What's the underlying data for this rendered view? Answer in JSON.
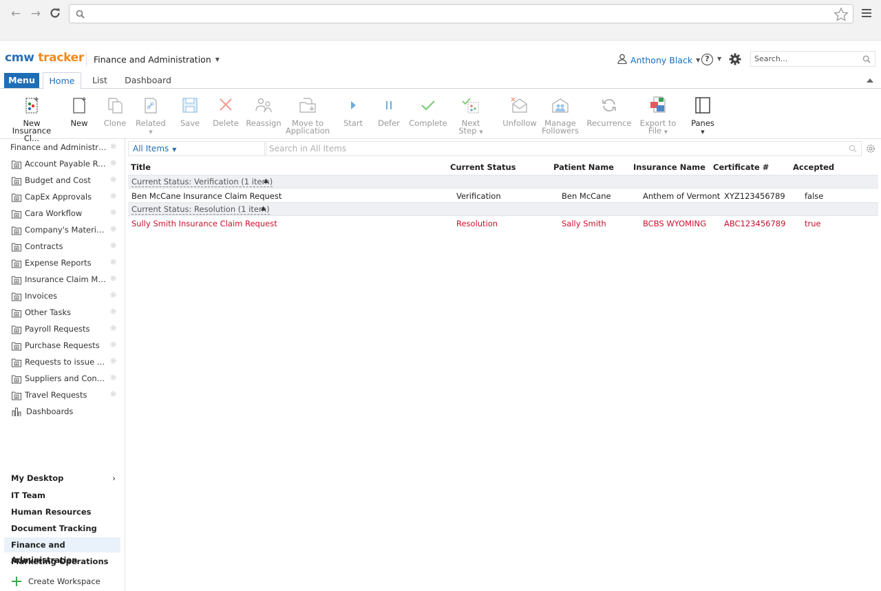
{
  "browser": {
    "url": ""
  },
  "header": {
    "logo_part1": "cmw",
    "logo_part2": "tracker",
    "workspace": "Finance and Administration",
    "user": "Anthony Black",
    "help": "?",
    "search_placeholder": "Search..."
  },
  "tabs": {
    "menu": "Menu",
    "home": "Home",
    "list": "List",
    "dashboard": "Dashboard"
  },
  "ribbon": {
    "new_insurance_l1": "New",
    "new_insurance_l2": "Insurance Cl...",
    "new": "New",
    "clone": "Clone",
    "related": "Related",
    "save": "Save",
    "delete": "Delete",
    "reassign": "Reassign",
    "move_l1": "Move to",
    "move_l2": "Application",
    "start": "Start",
    "defer": "Defer",
    "complete": "Complete",
    "next_l1": "Next",
    "next_l2": "Step",
    "unfollow": "Unfollow",
    "manage_l1": "Manage",
    "manage_l2": "Followers",
    "recurrence": "Recurrence",
    "export_l1": "Export to",
    "export_l2": "File",
    "panes": "Panes"
  },
  "sidebar": {
    "workspace_title": "Finance and Administrati...",
    "items": [
      "Account Payable Req...",
      "Budget and Cost",
      "CapEx Approvals",
      "Cara Workflow",
      "Company's Material ...",
      "Contracts",
      "Expense Reports",
      "Insurance Claim Ma...",
      "Invoices",
      "Other Tasks",
      "Payroll Requests",
      "Purchase Requests",
      "Requests to issue M...",
      "Suppliers and Contr...",
      "Travel Requests"
    ],
    "dashboards": "Dashboards",
    "workspaces": [
      "My Desktop",
      "IT Team",
      "Human Resources",
      "Document Tracking",
      "Finance and Administration",
      "Marketing Operations"
    ],
    "create_workspace": "Create Workspace"
  },
  "main": {
    "view": "All Items",
    "search_placeholder": "Search in All Items",
    "columns": [
      "Title",
      "Current Status",
      "Patient Name",
      "Insurance Name",
      "Certificate #",
      "Accepted"
    ],
    "groups": [
      {
        "label": "Current Status: Verification (1 item)",
        "row": [
          "Ben McCane Insurance Claim Request",
          "Verification",
          "Ben McCane",
          "Anthem of Vermont",
          "XYZ123456789",
          "false"
        ]
      },
      {
        "label": "Current Status: Resolution (1 item)",
        "row": [
          "Sully Smith Insurance Claim Request",
          "Resolution",
          "Sally Smith",
          "BCBS WYOMING",
          "ABC123456789",
          "true"
        ]
      }
    ]
  },
  "colors": {
    "brand_blue": "#1f6db5",
    "brand_orange": "#f08a1d",
    "overdue_red": "#c8102e"
  }
}
